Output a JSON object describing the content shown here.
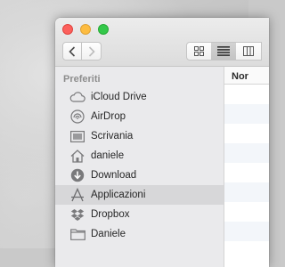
{
  "window": {
    "toolbar": {
      "back_icon": "chevron-left-icon",
      "forward_icon": "chevron-right-icon",
      "view_modes": [
        "icons",
        "list",
        "columns"
      ],
      "selected_view": "list"
    },
    "sidebar": {
      "section_title": "Preferiti",
      "items": [
        {
          "label": "iCloud Drive",
          "icon": "cloud-icon"
        },
        {
          "label": "AirDrop",
          "icon": "airdrop-icon"
        },
        {
          "label": "Scrivania",
          "icon": "desktop-icon"
        },
        {
          "label": "daniele",
          "icon": "home-icon"
        },
        {
          "label": "Download",
          "icon": "download-icon"
        },
        {
          "label": "Applicazioni",
          "icon": "applications-icon",
          "selected": true
        },
        {
          "label": "Dropbox",
          "icon": "dropbox-icon"
        },
        {
          "label": "Daniele",
          "icon": "folder-icon"
        }
      ]
    },
    "content": {
      "column_header": "Nor"
    }
  },
  "colors": {
    "close": "#fc605c",
    "minimize": "#fdbc40",
    "zoom": "#34c84a",
    "sidebar_icon": "#7a7a7c",
    "sidebar_selected": "#d7d7d9"
  }
}
